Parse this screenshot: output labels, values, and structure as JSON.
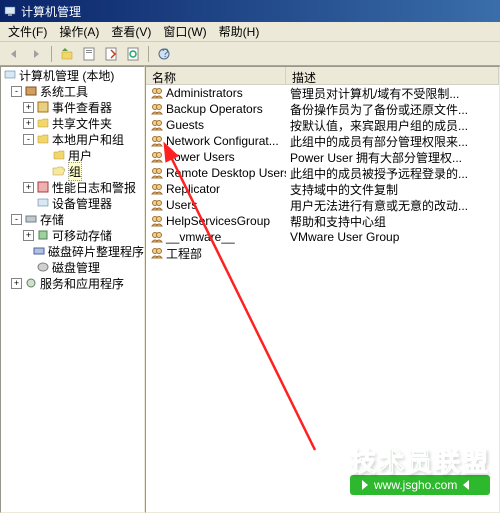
{
  "window": {
    "title": "计算机管理"
  },
  "menu": [
    "文件(F)",
    "操作(A)",
    "查看(V)",
    "窗口(W)",
    "帮助(H)"
  ],
  "tree": {
    "root": "计算机管理 (本地)",
    "sys_tools": "系统工具",
    "event_viewer": "事件查看器",
    "shared_folders": "共享文件夹",
    "local_users": "本地用户和组",
    "users": "用户",
    "groups": "组",
    "perf_logs": "性能日志和警报",
    "dev_mgr": "设备管理器",
    "storage": "存储",
    "removable": "可移动存储",
    "defrag": "磁盘碎片整理程序",
    "disk_mgmt": "磁盘管理",
    "services": "服务和应用程序"
  },
  "list": {
    "col_name": "名称",
    "col_desc": "描述",
    "col1_width": 140,
    "rows": [
      {
        "name": "Administrators",
        "desc": "管理员对计算机/域有不受限制..."
      },
      {
        "name": "Backup Operators",
        "desc": "备份操作员为了备份或还原文件..."
      },
      {
        "name": "Guests",
        "desc": "按默认值，来宾跟用户组的成员..."
      },
      {
        "name": "Network Configurat...",
        "desc": "此组中的成员有部分管理权限来..."
      },
      {
        "name": "Power Users",
        "desc": "Power User 拥有大部分管理权..."
      },
      {
        "name": "Remote Desktop Users",
        "desc": "此组中的成员被授予远程登录的..."
      },
      {
        "name": "Replicator",
        "desc": "支持域中的文件复制"
      },
      {
        "name": "Users",
        "desc": "用户无法进行有意或无意的改动..."
      },
      {
        "name": "HelpServicesGroup",
        "desc": "帮助和支持中心组"
      },
      {
        "name": "__vmware__",
        "desc": "VMware User Group"
      },
      {
        "name": "工程部",
        "desc": ""
      }
    ]
  },
  "watermark": {
    "text": "技术员联盟",
    "url": "www.jsgho.com"
  }
}
